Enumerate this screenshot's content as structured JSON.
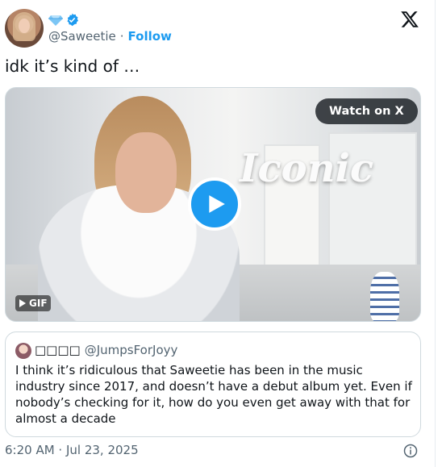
{
  "author": {
    "handle": "@Saweetie",
    "separator": "·",
    "follow_label": "Follow"
  },
  "tweet": {
    "text": "idk it’s kind of …"
  },
  "media": {
    "watch_label": "Watch on X",
    "overlay_text": "Iconic",
    "gif_label": "GIF"
  },
  "quote": {
    "name": "□□□□",
    "handle": "@JumpsForJoyy",
    "text": "I think it’s ridiculous that Saweetie has been in the music industry since 2017, and doesn’t have a debut album yet. Even if nobody’s checking for it, how do you even get away with that for almost a decade"
  },
  "footer": {
    "timestamp": "6:20 AM · Jul 23, 2025"
  },
  "colors": {
    "accent": "#1d9bf0",
    "secondary_text": "#536471",
    "border": "#cfd9de"
  }
}
